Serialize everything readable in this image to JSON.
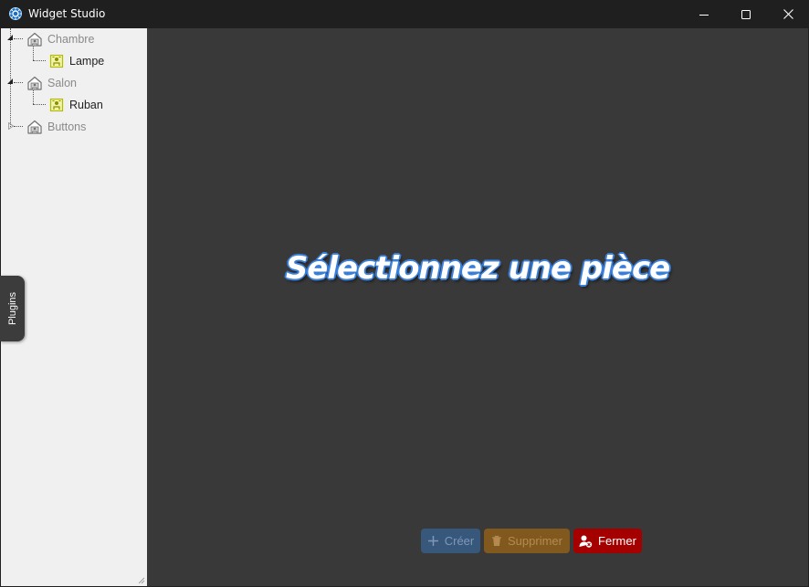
{
  "window": {
    "title": "Widget Studio",
    "controls": [
      "minimize-icon",
      "maximize-icon",
      "close-icon"
    ]
  },
  "tree": {
    "items": [
      {
        "label": "Chambre",
        "type": "room",
        "expanded": true,
        "icon": "house-icon"
      },
      {
        "label": "Lampe",
        "type": "widget",
        "icon": "lamp-widget-icon"
      },
      {
        "label": "Salon",
        "type": "room",
        "expanded": true,
        "icon": "house-icon"
      },
      {
        "label": "Ruban",
        "type": "widget",
        "icon": "lamp-widget-icon"
      },
      {
        "label": "Buttons",
        "type": "room",
        "expanded": false,
        "icon": "house-icon"
      }
    ]
  },
  "plugins_tab": {
    "label": "Plugins"
  },
  "main": {
    "placeholder": "Sélectionnez une pièce"
  },
  "actions": {
    "create": {
      "label": "Créer",
      "icon": "plus-icon",
      "enabled": false
    },
    "delete": {
      "label": "Supprimer",
      "icon": "trash-icon",
      "enabled": false
    },
    "close": {
      "label": "Fermer",
      "icon": "user-close-icon",
      "enabled": true
    }
  },
  "colors": {
    "title_bar": "#1f1f1f",
    "sidebar_bg": "#f0f0f0",
    "main_bg": "#3a3939",
    "accent_blue": "#3a7fd8",
    "create_bg": "#37577b",
    "delete_bg": "#81591f",
    "close_bg": "#a40000"
  }
}
